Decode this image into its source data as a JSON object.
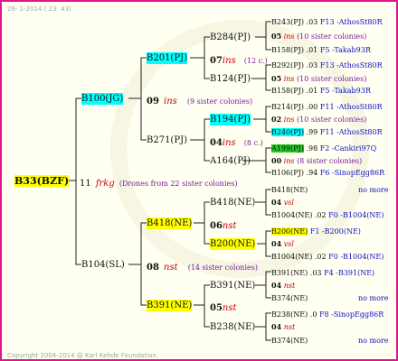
{
  "header": {
    "date": "28- 1-2014 ( 23: 43)"
  },
  "footer": {
    "copyright": "Copyright 2004-2014 @ Karl Kehde Foundation."
  },
  "colors": {
    "frame": "#e0148c",
    "highlight_yellow": "#ffff00",
    "highlight_cyan": "#00ffff",
    "highlight_green": "#22cc22"
  },
  "root": {
    "id": "B33(BZF)",
    "mating": {
      "year": "11",
      "code": "frkg",
      "note": "(Drones from 22 sister colonies)"
    }
  },
  "gen1": [
    {
      "id": "B100(JG)",
      "year": "09",
      "code": "ins",
      "note": "(9 sister colonies)"
    },
    {
      "id": "B104(SL)",
      "year": "08",
      "code": "nst",
      "note": "(14 sister colonies)"
    }
  ],
  "gen2": [
    {
      "id": "B201(PJ)",
      "year": "07",
      "code": "ins",
      "note": "(12 c.)"
    },
    {
      "id": "B271(PJ)",
      "year": "04",
      "code": "ins",
      "note": "(8 c.)"
    },
    {
      "id": "B418(NE)",
      "year": "06",
      "code": "nst"
    },
    {
      "id": "B391(NE)",
      "year": "05",
      "code": "nst"
    }
  ],
  "gen3": [
    {
      "id": "B284(PJ)"
    },
    {
      "id": "B124(PJ)"
    },
    {
      "id": "B194(PJ)"
    },
    {
      "id": "A164(PJ)"
    },
    {
      "id": "B418(NE)"
    },
    {
      "id": "B200(NE)"
    },
    {
      "id": "B391(NE)"
    },
    {
      "id": "B238(NE)"
    }
  ],
  "gen4": [
    {
      "id": "B243(PJ)",
      "year": ".03",
      "origin": "F13 -AthosSt80R"
    },
    {
      "id": "B158(PJ)",
      "year": ".01",
      "origin": "F5 -Takab93R"
    },
    {
      "id": "B292(PJ)",
      "year": ".03",
      "origin": "F13 -AthosSt80R"
    },
    {
      "id": "B158(PJ)",
      "year": ".01",
      "origin": "F5 -Takab93R"
    },
    {
      "id": "B214(PJ)",
      "year": ".00",
      "origin": "F11 -AthosSt80R"
    },
    {
      "id": "B240(PJ)",
      "year": ".99",
      "origin": "F11 -AthosSt80R"
    },
    {
      "id": "A199(PJ)",
      "year": ".98",
      "origin": "F2 -Cankiri97Q"
    },
    {
      "id": "B106(PJ)",
      "year": ".94",
      "origin": "F6 -SinopEgg86R"
    },
    {
      "id": "B418(NE)",
      "origin": "no more"
    },
    {
      "id": "B1004(NE)",
      "year": ".02",
      "origin": "F0 -B1004(NE)"
    },
    {
      "id": "B200(NE)",
      "year": ".02",
      "origin": "F1 -B200(NE)"
    },
    {
      "id": "B1004(NE)",
      "year": ".02",
      "origin": "F0 -B1004(NE)"
    },
    {
      "id": "B391(NE)",
      "year": ".03",
      "origin": "F4 -B391(NE)"
    },
    {
      "id": "B374(NE)",
      "origin": "no more"
    },
    {
      "id": "B238(NE)",
      "year": ".0",
      "origin": "F8 -SinopEgg86R"
    },
    {
      "id": "B374(NE)",
      "origin": "no more"
    }
  ],
  "gen4m": [
    {
      "year": "05",
      "code": "ins",
      "note": "(10 sister colonies)"
    },
    {
      "year": "05",
      "code": "ins",
      "note": "(10 sister colonies)"
    },
    {
      "year": "02",
      "code": "ins",
      "note": "(10 sister colonies)"
    },
    {
      "year": "00",
      "code": "ins",
      "note": "(8 sister colonies)"
    },
    {
      "year": "04",
      "code": "vsl"
    },
    {
      "year": "04",
      "code": "vsl"
    },
    {
      "year": "04",
      "code": "nst"
    },
    {
      "year": "04",
      "code": "nst"
    }
  ]
}
